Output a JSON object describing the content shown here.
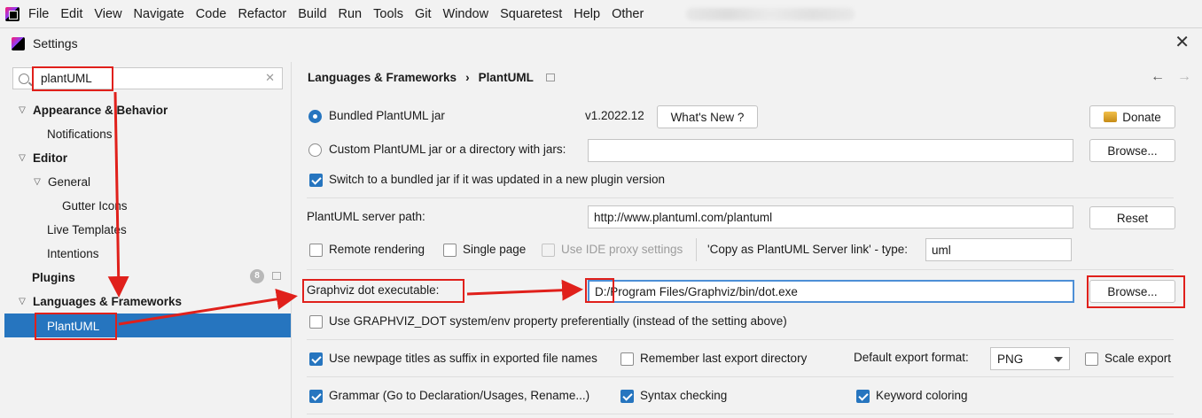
{
  "menubar": {
    "items": [
      "File",
      "Edit",
      "View",
      "Navigate",
      "Code",
      "Refactor",
      "Build",
      "Run",
      "Tools",
      "Git",
      "Window",
      "Squaretest",
      "Help",
      "Other"
    ]
  },
  "dialog": {
    "title": "Settings"
  },
  "sidebar": {
    "search_value": "plantUML",
    "tree": [
      {
        "label": "Appearance & Behavior",
        "bold": true,
        "expanded": true
      },
      {
        "label": "Notifications"
      },
      {
        "label": "Editor",
        "bold": true,
        "expanded": true
      },
      {
        "label": "General",
        "expanded": true
      },
      {
        "label": "Gutter Icons"
      },
      {
        "label": "Live Templates"
      },
      {
        "label": "Intentions"
      },
      {
        "label": "Plugins",
        "bold": true,
        "badge": "8"
      },
      {
        "label": "Languages & Frameworks",
        "bold": true,
        "expanded": true
      },
      {
        "label": "PlantUML",
        "selected": true
      }
    ]
  },
  "main": {
    "breadcrumb": [
      "Languages & Frameworks",
      "PlantUML"
    ],
    "bundled_label": "Bundled PlantUML jar",
    "bundled_version": "v1.2022.12",
    "whats_new": "What's New ?",
    "donate": "Donate",
    "custom_label": "Custom PlantUML jar or a directory with jars:",
    "custom_value": "",
    "browse1": "Browse...",
    "switch_label": "Switch to a bundled jar if it was updated in a new plugin version",
    "server_label": "PlantUML server path:",
    "server_value": "http://www.plantuml.com/plantuml",
    "reset": "Reset",
    "remote_rendering": "Remote rendering",
    "single_page": "Single page",
    "ide_proxy": "Use IDE proxy settings",
    "copy_link_label": "'Copy as PlantUML Server link' - type:",
    "copy_link_value": "uml",
    "graphviz_label": "Graphviz dot executable:",
    "graphviz_value": "D:/Program Files/Graphviz/bin/dot.exe",
    "browse2": "Browse...",
    "graphviz_env": "Use GRAPHVIZ_DOT system/env property preferentially (instead of the setting above)",
    "newpage_titles": "Use newpage titles as suffix in exported file names",
    "remember_dir": "Remember last export directory",
    "export_format_label": "Default export format:",
    "export_format_value": "PNG",
    "scale_export": "Scale export",
    "grammar": "Grammar (Go to Declaration/Usages, Rename...)",
    "syntax_checking": "Syntax checking",
    "keyword_coloring": "Keyword coloring"
  },
  "colors": {
    "accent": "#2675bf",
    "annotation": "#e0201b"
  }
}
